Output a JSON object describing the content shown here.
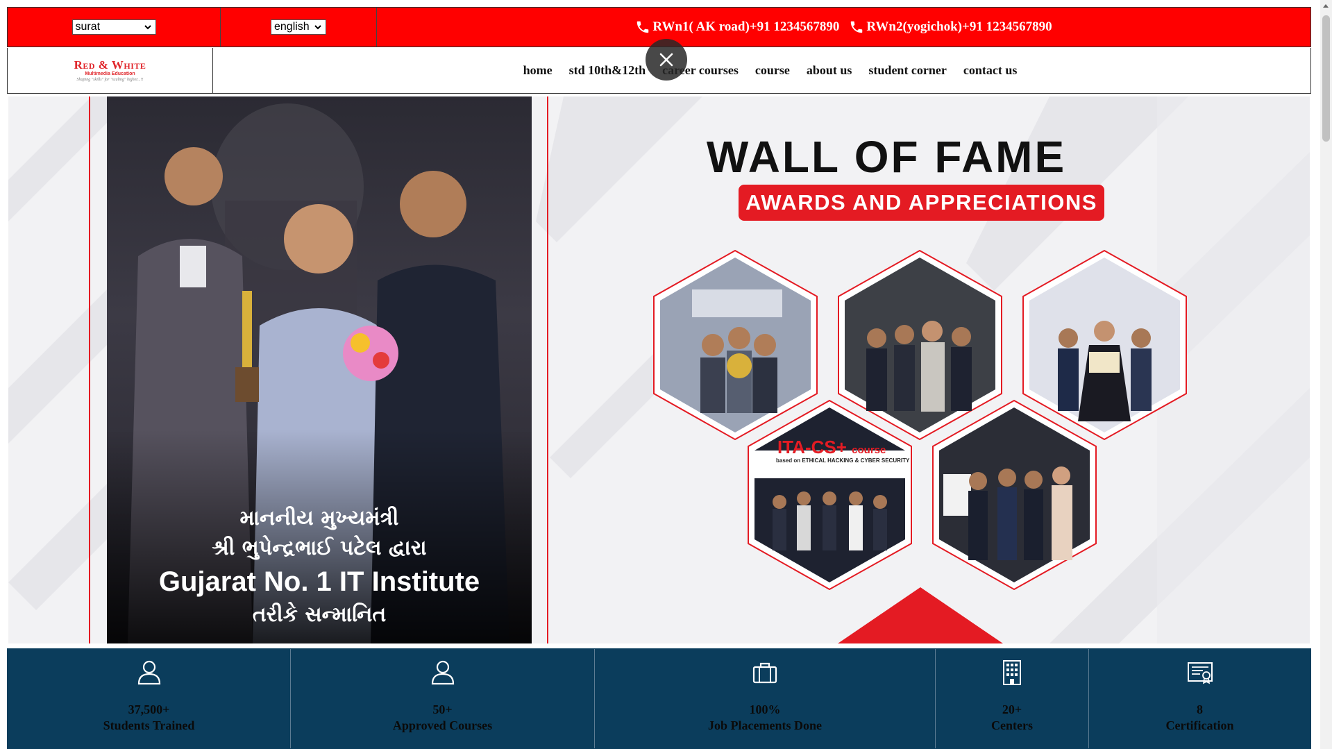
{
  "topbar": {
    "city_select": "surat",
    "language_select": "english",
    "phones": [
      "RWn1( AK road)+91 1234567890",
      "RWn2(yogichok)+91 1234567890"
    ]
  },
  "logo": {
    "name": "Red & White",
    "subtitle": "Multimedia Education",
    "tagline": "Shaping \"skills\" for \"scaling\" higher...!!"
  },
  "nav": {
    "items": [
      "home",
      "std 10th&12th",
      "career courses",
      "course",
      "about us",
      "student corner",
      "contact us"
    ]
  },
  "banner": {
    "caption_line1": "માનનીય મુખ્યમંત્રી",
    "caption_line2": "શ્રી ભુપેન્દ્રભાઈ પટેલ દ્વારા",
    "caption_line3": "Gujarat No. 1 IT Institute",
    "caption_line4": "તરીકે સન્માનિત",
    "title": "WALL OF FAME",
    "subtitle": "AWARDS AND APPRECIATIONS",
    "hex_label_course": "ITA-CS+",
    "hex_label_course_suffix": "course",
    "hex_label_course_sub": "based on ETHICAL HACKING & CYBER SECURITY",
    "accent_color": "#e41b23"
  },
  "stats": [
    {
      "value": "37,500+",
      "label": "Students Trained",
      "icon": "user-icon"
    },
    {
      "value": "50+",
      "label": "Approved Courses",
      "icon": "user-icon"
    },
    {
      "value": "100%",
      "label": "Job Placements Done",
      "icon": "briefcase-icon"
    },
    {
      "value": "20+",
      "label": "Centers",
      "icon": "building-icon"
    },
    {
      "value": "8",
      "label": "Certification",
      "icon": "certificate-icon"
    }
  ],
  "colors": {
    "topbar_bg": "#ff0000",
    "stats_bg": "#0b3d5c",
    "brand_red": "#e0262b"
  }
}
